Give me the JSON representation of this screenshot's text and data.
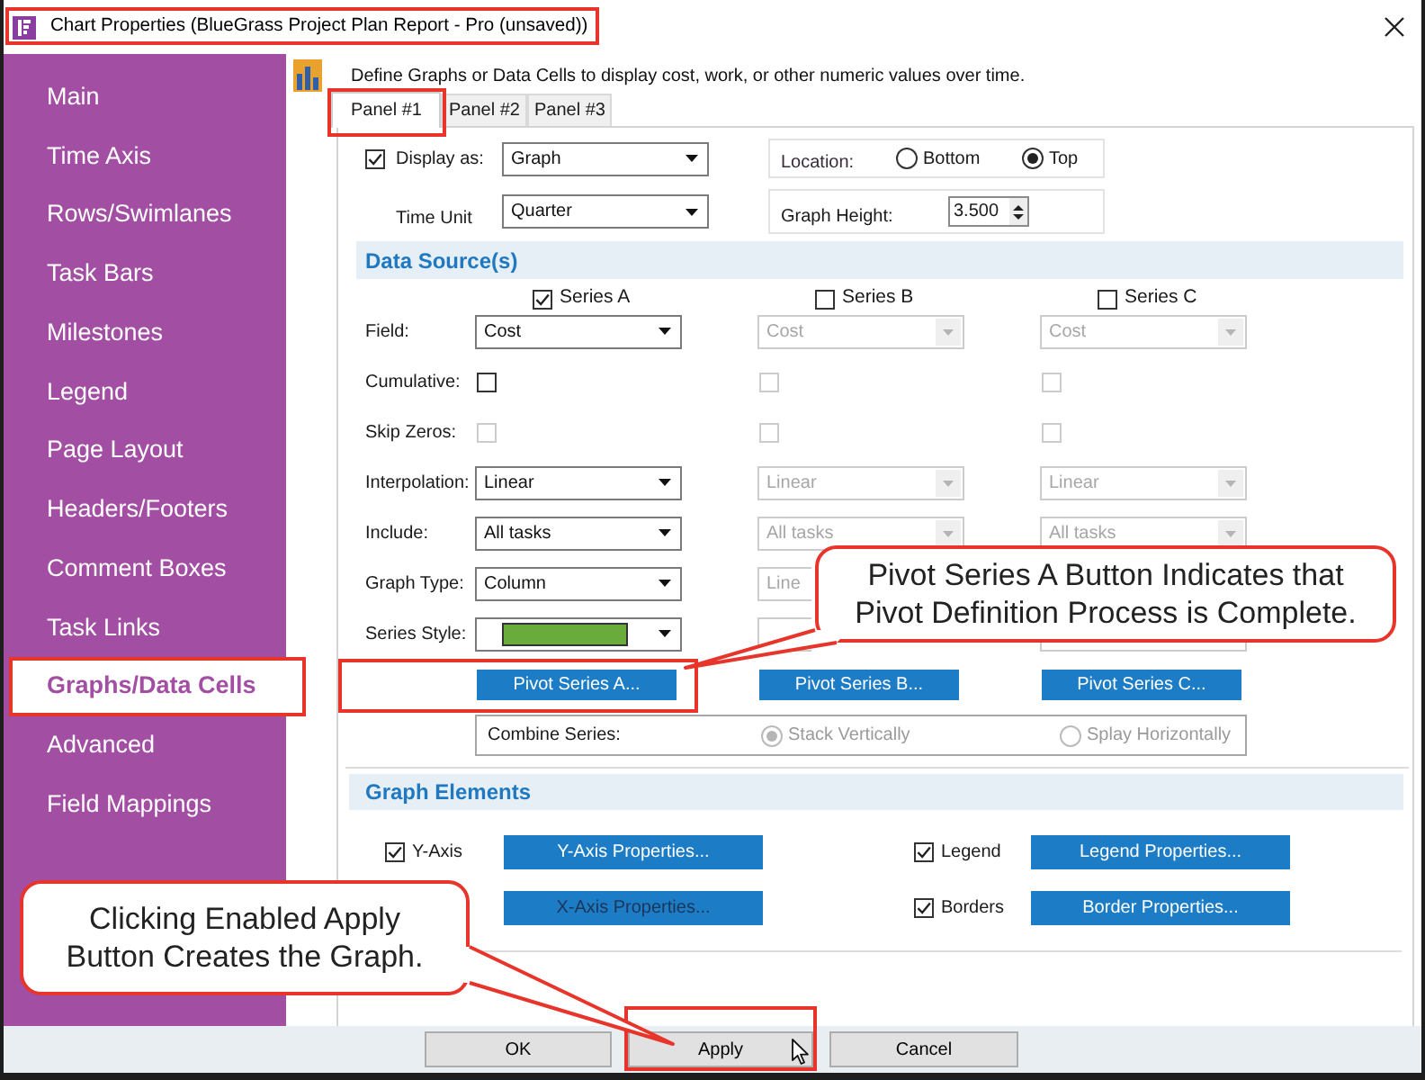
{
  "window": {
    "title": "Chart Properties (BlueGrass Project Plan Report - Pro (unsaved))",
    "highlighted": true
  },
  "sidebar": {
    "items": [
      {
        "label": "Main",
        "selected": false,
        "highlighted": false
      },
      {
        "label": "Time Axis",
        "selected": false,
        "highlighted": false
      },
      {
        "label": "Rows/Swimlanes",
        "selected": false,
        "highlighted": false
      },
      {
        "label": "Task Bars",
        "selected": false,
        "highlighted": false
      },
      {
        "label": "Milestones",
        "selected": false,
        "highlighted": false
      },
      {
        "label": "Legend",
        "selected": false,
        "highlighted": false
      },
      {
        "label": "Page Layout",
        "selected": false,
        "highlighted": false
      },
      {
        "label": "Headers/Footers",
        "selected": false,
        "highlighted": false
      },
      {
        "label": "Comment Boxes",
        "selected": false,
        "highlighted": false
      },
      {
        "label": "Task Links",
        "selected": false,
        "highlighted": false
      },
      {
        "label": "Graphs/Data Cells",
        "selected": true,
        "highlighted": true
      },
      {
        "label": "Advanced",
        "selected": false,
        "highlighted": false
      },
      {
        "label": "Field Mappings",
        "selected": false,
        "highlighted": false
      }
    ]
  },
  "header": {
    "description": "Define Graphs or Data Cells to display cost, work, or other numeric values over time."
  },
  "tabs": [
    {
      "label": "Panel #1",
      "selected": true,
      "highlighted": true
    },
    {
      "label": "Panel #2",
      "selected": false,
      "highlighted": false
    },
    {
      "label": "Panel #3",
      "selected": false,
      "highlighted": false
    }
  ],
  "display": {
    "display_as": {
      "label": "Display as:",
      "checked": true,
      "value": "Graph"
    },
    "location": {
      "label": "Location:",
      "options": [
        {
          "label": "Bottom",
          "selected": false
        },
        {
          "label": "Top",
          "selected": true
        }
      ]
    },
    "time_unit": {
      "label": "Time Unit",
      "value": "Quarter"
    },
    "graph_height": {
      "label": "Graph Height:",
      "value": "3.500"
    }
  },
  "data_sources": {
    "title": "Data Source(s)",
    "series": [
      {
        "label": "Series A",
        "checked": true
      },
      {
        "label": "Series B",
        "checked": false
      },
      {
        "label": "Series C",
        "checked": false
      }
    ],
    "rows": [
      {
        "label": "Field:",
        "kind": "dropdown",
        "cells": [
          {
            "value": "Cost",
            "disabled": false
          },
          {
            "value": "Cost",
            "disabled": true
          },
          {
            "value": "Cost",
            "disabled": true
          }
        ]
      },
      {
        "label": "Cumulative:",
        "kind": "checkbox",
        "cells": [
          {
            "checked": false,
            "disabled": false
          },
          {
            "checked": false,
            "disabled": true
          },
          {
            "checked": false,
            "disabled": true
          }
        ]
      },
      {
        "label": "Skip Zeros:",
        "kind": "checkbox",
        "cells": [
          {
            "checked": false,
            "disabled": true
          },
          {
            "checked": false,
            "disabled": true
          },
          {
            "checked": false,
            "disabled": true
          }
        ]
      },
      {
        "label": "Interpolation:",
        "kind": "dropdown",
        "cells": [
          {
            "value": "Linear",
            "disabled": false
          },
          {
            "value": "Linear",
            "disabled": true
          },
          {
            "value": "Linear",
            "disabled": true
          }
        ]
      },
      {
        "label": "Include:",
        "kind": "dropdown",
        "cells": [
          {
            "value": "All tasks",
            "disabled": false
          },
          {
            "value": "All tasks",
            "disabled": true
          },
          {
            "value": "All tasks",
            "disabled": true
          }
        ]
      },
      {
        "label": "Graph Type:",
        "kind": "dropdown",
        "cells": [
          {
            "value": "Column",
            "disabled": false
          },
          {
            "value": "Line",
            "disabled": true
          }
        ]
      },
      {
        "label": "Series Style:",
        "kind": "swatch",
        "cells": [
          {
            "color": "#6aac3c",
            "disabled": false
          },
          {
            "disabled": true
          },
          {
            "disabled": true
          }
        ]
      }
    ],
    "pivot_buttons": [
      {
        "label": "Pivot Series A...",
        "highlighted": true
      },
      {
        "label": "Pivot Series B...",
        "highlighted": false
      },
      {
        "label": "Pivot Series C...",
        "highlighted": false
      }
    ],
    "combine": {
      "label": "Combine Series:",
      "disabled": true,
      "options": [
        {
          "label": "Stack Vertically",
          "selected": true
        },
        {
          "label": "Splay Horizontally",
          "selected": false
        }
      ]
    }
  },
  "graph_elements": {
    "title": "Graph Elements",
    "items": [
      {
        "label": "Y-Axis",
        "checked": true,
        "button": "Y-Axis Properties...",
        "disabled": false
      },
      {
        "label": "Legend",
        "checked": true,
        "button": "Legend Properties...",
        "disabled": false
      },
      {
        "button": "X-Axis Properties...",
        "disabled": true
      },
      {
        "label": "Borders",
        "checked": true,
        "button": "Border Properties...",
        "disabled": false
      }
    ]
  },
  "footer": {
    "buttons": [
      {
        "label": "OK",
        "highlighted": false
      },
      {
        "label": "Apply",
        "highlighted": true
      },
      {
        "label": "Cancel",
        "highlighted": false
      }
    ]
  },
  "callouts": [
    {
      "text": "Pivot Series A Button Indicates that Pivot Definition Process is Complete."
    },
    {
      "text": "Clicking Enabled Apply Button Creates the Graph."
    }
  ]
}
